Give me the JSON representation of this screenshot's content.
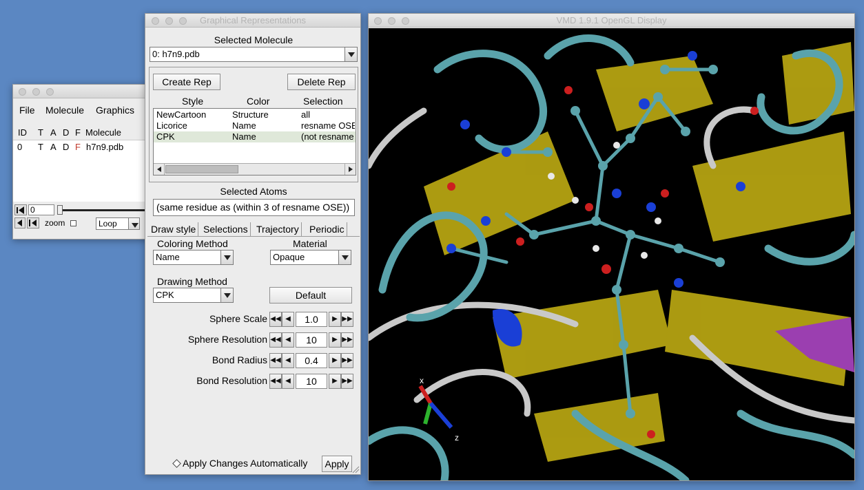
{
  "main": {
    "menu": [
      "File",
      "Molecule",
      "Graphics"
    ],
    "columns": [
      "ID",
      "T",
      "A",
      "D",
      "F",
      "Molecule"
    ],
    "row": {
      "id": "0",
      "t": "T",
      "a": "A",
      "d": "D",
      "f": "F",
      "molecule": "h7n9.pdb"
    },
    "frame_value": "0",
    "zoom_label": "zoom",
    "loop_value": "Loop"
  },
  "reps": {
    "title": "Graphical Representations",
    "selected_molecule_label": "Selected Molecule",
    "selected_molecule_value": "0: h7n9.pdb",
    "create_rep": "Create Rep",
    "delete_rep": "Delete Rep",
    "headers": {
      "style": "Style",
      "color": "Color",
      "selection": "Selection"
    },
    "rows": [
      {
        "style": "NewCartoon",
        "color": "Structure",
        "selection": "all"
      },
      {
        "style": "Licorice",
        "color": "Name",
        "selection": "resname OSE"
      },
      {
        "style": "CPK",
        "color": "Name",
        "selection": "(not resname OSE)"
      }
    ],
    "selected_atoms_label": "Selected Atoms",
    "selected_atoms_value": "(same residue as (within 3 of resname OSE))",
    "tabs": [
      "Draw style",
      "Selections",
      "Trajectory",
      "Periodic"
    ],
    "coloring_method_label": "Coloring Method",
    "coloring_method_value": "Name",
    "material_label": "Material",
    "material_value": "Opaque",
    "drawing_method_label": "Drawing Method",
    "drawing_method_value": "CPK",
    "default_button": "Default",
    "params": [
      {
        "label": "Sphere Scale",
        "value": "1.0"
      },
      {
        "label": "Sphere Resolution",
        "value": "10"
      },
      {
        "label": "Bond Radius",
        "value": "0.4"
      },
      {
        "label": "Bond Resolution",
        "value": "10"
      }
    ],
    "apply_auto_label": "Apply Changes Automatically",
    "apply_button": "Apply"
  },
  "display": {
    "title": "VMD 1.9.1 OpenGL Display",
    "axis_x": "x",
    "axis_z": "z"
  },
  "colors": {
    "desktop": "#5b87c2",
    "ribbon_teal": "#5aa3ab",
    "sheet_yellow": "#b5a312",
    "atom_nitrogen": "#1a3fd6",
    "atom_oxygen": "#cc1f1f",
    "atom_hydrogen": "#e8e8e8"
  }
}
